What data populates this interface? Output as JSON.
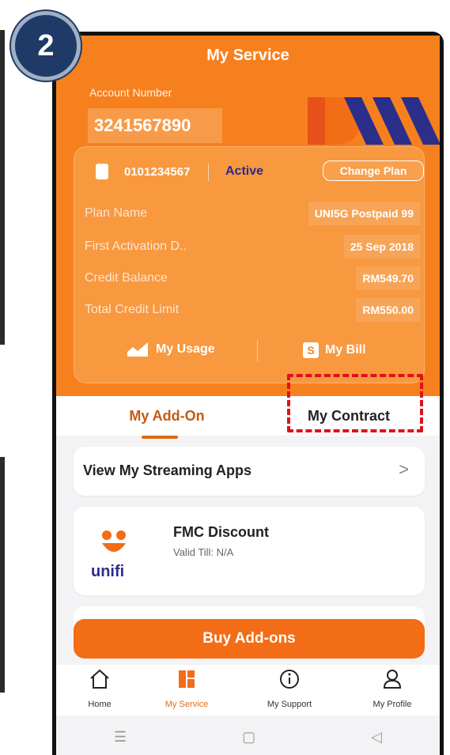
{
  "step_badge": "2",
  "header": {
    "title": "My Service",
    "account_label": "Account Number",
    "account_number": "3241567890"
  },
  "line": {
    "number": "0101234567",
    "status": "Active",
    "change_plan_label": "Change Plan",
    "status_color": "#2c2a8e"
  },
  "details": [
    {
      "label": "Plan Name",
      "value": "UNI5G Postpaid 99"
    },
    {
      "label": "First Activation D..",
      "value": "25 Sep 2018"
    },
    {
      "label": "Credit Balance",
      "value": "RM549.70"
    },
    {
      "label": "Total Credit Limit",
      "value": "RM550.00"
    }
  ],
  "card_actions": {
    "usage_label": "My Usage",
    "bill_label": "My Bill",
    "bill_icon_glyph": "S"
  },
  "tabs": [
    {
      "label": "My Add-On",
      "active": true
    },
    {
      "label": "My Contract",
      "active": false
    }
  ],
  "streaming": {
    "label": "View My Streaming Apps",
    "arrow": ">"
  },
  "fmc": {
    "title": "FMC Discount",
    "subtitle": "Valid Till: N/A",
    "logo_text": "unifi"
  },
  "buy_button": "Buy Add-ons",
  "bottom_nav": [
    {
      "label": "Home",
      "icon": "home-icon"
    },
    {
      "label": "My Service",
      "icon": "service-icon",
      "active": true
    },
    {
      "label": "My Support",
      "icon": "info-icon"
    },
    {
      "label": "My Profile",
      "icon": "profile-icon"
    }
  ],
  "system_nav": {
    "menu": "☰",
    "home": "▢",
    "back": "◁"
  },
  "colors": {
    "brand_orange": "#f7801e",
    "button_orange": "#f36c16",
    "highlight_red": "#e0121a",
    "badge_blue": "#1f3a66"
  }
}
